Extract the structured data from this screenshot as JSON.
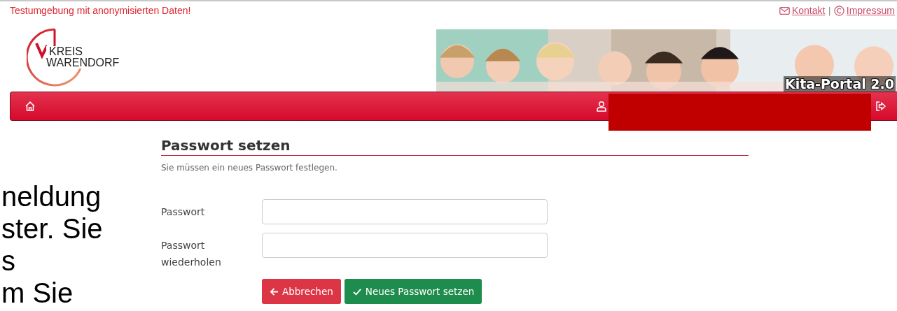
{
  "notice": "Testumgebung mit anonymisierten Daten!",
  "top_links": [
    {
      "kind": "mail",
      "label": "Kontakt"
    },
    {
      "kind": "copyright",
      "label": "Impressum"
    }
  ],
  "top_links_separator": "|",
  "logo": {
    "line_1": "KREIS",
    "line_2": "WARENDORF"
  },
  "banner": {
    "kind": "picture",
    "title": "Kita-Portal 2.0"
  },
  "navbar": {
    "items": [
      {
        "kind": "home"
      },
      {
        "kind": "user"
      },
      {
        "kind": "logout"
      }
    ],
    "redacted": true
  },
  "page": {
    "title": "Passwort setzen",
    "subtitle": "Sie müssen ein neues Passwort festlegen.",
    "fields": [
      {
        "label": "Passwort"
      },
      {
        "label": "Passwort wiederholen"
      }
    ],
    "buttons": [
      {
        "kind": "cancel",
        "label": "Abbrechen"
      },
      {
        "kind": "submit",
        "label": "Neues Passwort setzen"
      }
    ]
  },
  "overlay_text": [
    "neldung",
    "ster. Sie",
    "s",
    "m Sie"
  ]
}
